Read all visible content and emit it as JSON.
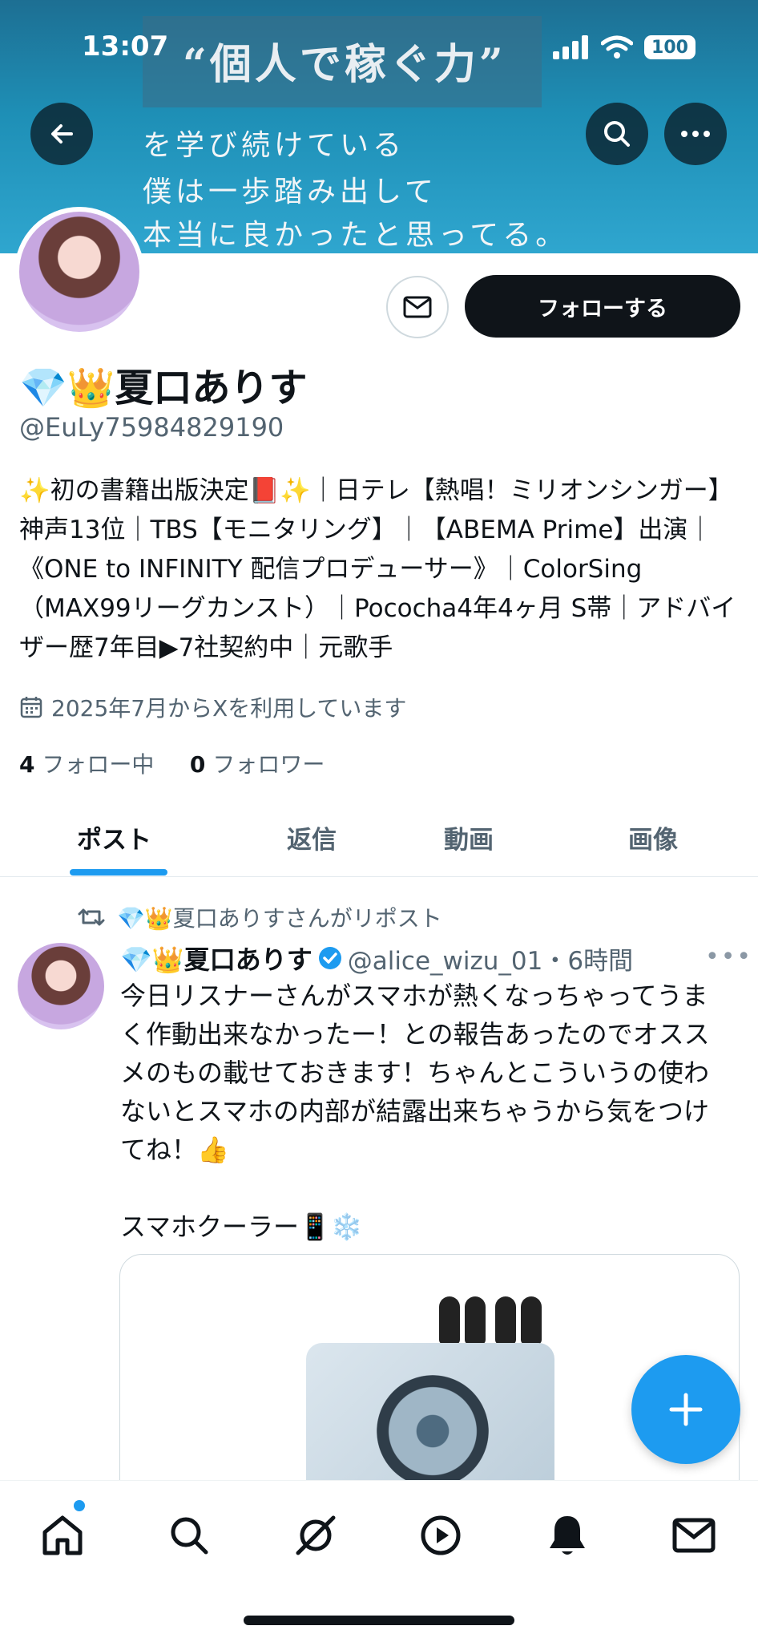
{
  "status_bar": {
    "time": "13:07",
    "battery": "100"
  },
  "banner": {
    "quote": "“個人で稼ぐ力”",
    "line1": "を学び続けている",
    "line2": "僕は一歩踏み出して",
    "line3": "本当に良かったと思ってる。"
  },
  "profile": {
    "follow_label": "フォローする",
    "name": "💎👑夏口ありす",
    "handle": "@EuLy75984829190",
    "bio": "✨初の書籍出版決定📕✨｜日テレ【熱唱！ミリオンシンガー】神声13位｜TBS【モニタリング】｜【ABEMA Prime】出演｜《ONE to INFINITY 配信プロデューサー》｜ColorSing（MAX99リーグカンスト）｜Pococha4年4ヶ月 S帯｜アドバイザー歴7年目▶7社契約中｜元歌手",
    "joined": "2025年7月からXを利用しています",
    "following_count": "4",
    "following_label": "フォロー中",
    "followers_count": "0",
    "followers_label": "フォロワー"
  },
  "tabs": [
    {
      "label": "ポスト",
      "active": true
    },
    {
      "label": "返信",
      "active": false
    },
    {
      "label": "動画",
      "active": false
    },
    {
      "label": "画像",
      "active": false
    }
  ],
  "post": {
    "repost_label": "💎👑夏口ありすさんがリポスト",
    "author": "💎👑夏口ありす",
    "meta": "@alice_wizu_01・6時間",
    "text": "今日リスナーさんがスマホが熱くなっちゃってうまく作動出来なかったー！との報告あったのでオススメのもの載せておきます！ちゃんとこういうの使わないとスマホの内部が結露出来ちゃうから気をつけてね！👍\n\nスマホクーラー📱❄️"
  },
  "icons": {
    "back": "arrow-left-icon",
    "search": "search-icon",
    "more": "more-icon",
    "mail": "mail-icon",
    "calendar": "calendar-icon",
    "repost": "repost-icon",
    "verified": "verified-badge-icon",
    "compose": "plus-icon",
    "nav": [
      "home-icon",
      "search-icon",
      "grok-icon",
      "video-icon",
      "bell-icon",
      "mail-icon"
    ]
  },
  "colors": {
    "accent": "#1d9bf0",
    "text": "#0f1419",
    "muted": "#536471",
    "button_dark": "#0f1419"
  }
}
